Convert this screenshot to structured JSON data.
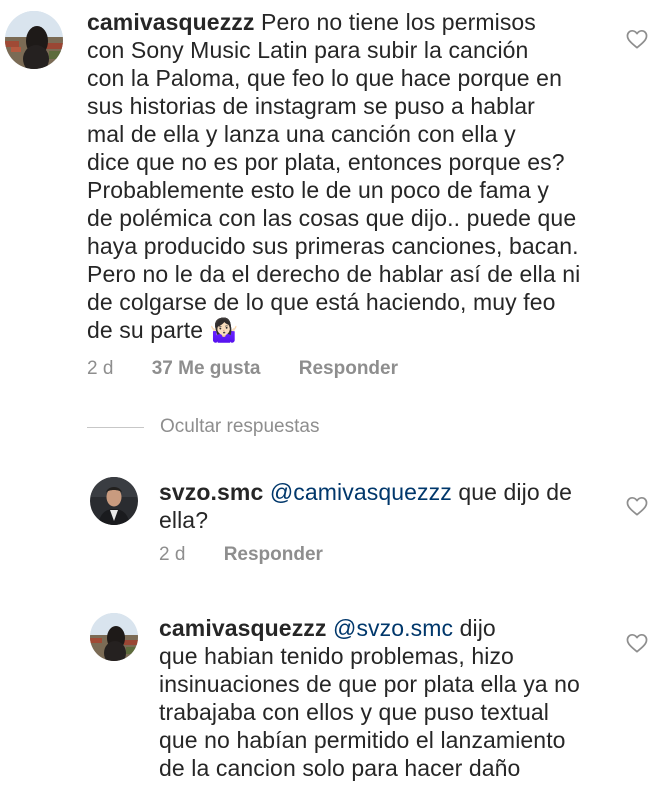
{
  "comments": [
    {
      "username": "camivasquezzz",
      "lines_first": "Pero no tiene los permisos",
      "lines": [
        "con Sony Music Latin para subir la canción",
        "con la Paloma, que feo lo que hace porque en",
        "sus historias de instagram se puso a hablar",
        "mal de ella y lanza una canción con ella y",
        "dice que no es por plata, entonces porque es?",
        "Probablemente esto le de un poco de fama y",
        "de polémica con las cosas que dijo.. puede que",
        "haya producido sus primeras canciones, bacan.",
        "Pero no le da el derecho de hablar así de ella ni",
        "de colgarse de lo que está haciendo, muy feo"
      ],
      "last_line": "de su parte",
      "emoji": "🤷🏻‍♀️",
      "time": "2 d",
      "likes": "37 Me gusta",
      "reply": "Responder"
    }
  ],
  "hide_replies": "Ocultar respuestas",
  "replies": [
    {
      "username": "svzo.smc",
      "mention": "@camivasquezzz",
      "rest_first": "que dijo de",
      "lines": [
        "ella?"
      ],
      "time": "2 d",
      "reply": "Responder"
    },
    {
      "username": "camivasquezzz",
      "mention": "@svzo.smc",
      "rest_first": "dijo",
      "lines": [
        "que habian tenido problemas, hizo",
        "insinuaciones de que por plata ella ya no",
        "trabajaba con ellos y que puso textual",
        "que no habían permitido el lanzamiento",
        "de la cancion solo para hacer daño"
      ]
    }
  ],
  "icons": {
    "like": "heart-outline-icon",
    "avatar_main": "avatar-landscape-person",
    "avatar_reply1": "avatar-man-suit",
    "avatar_reply2": "avatar-landscape-person"
  },
  "colors": {
    "text": "#262626",
    "muted": "#8e8e8e",
    "mention": "#00376b"
  }
}
